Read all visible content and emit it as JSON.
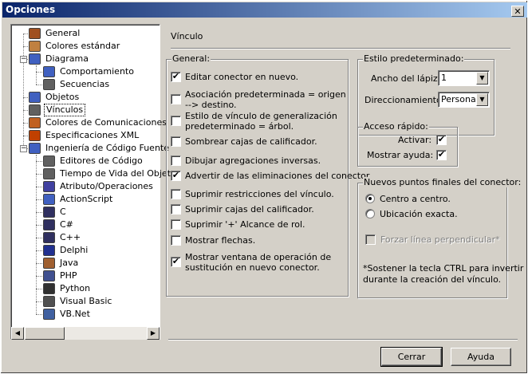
{
  "window": {
    "title": "Opciones",
    "close_glyph": "✕"
  },
  "tree": {
    "items": [
      {
        "label": "General",
        "icon": "general-icon",
        "color": "#a05020"
      },
      {
        "label": "Colores estándar",
        "icon": "colors-icon",
        "color": "#c08040"
      },
      {
        "label": "Diagrama",
        "icon": "diagram-icon",
        "color": "#4060c0"
      },
      {
        "label": "Comportamiento",
        "icon": "behavior-icon",
        "color": "#4060c0"
      },
      {
        "label": "Secuencias",
        "icon": "sequence-icon",
        "color": "#606060"
      },
      {
        "label": "Objetos",
        "icon": "objects-icon",
        "color": "#4060c0"
      },
      {
        "label": "Vínculos",
        "icon": "links-icon",
        "color": "#606060"
      },
      {
        "label": "Colores de Comunicaciones",
        "icon": "comm-colors-icon",
        "color": "#c06020"
      },
      {
        "label": "Especificaciones XML",
        "icon": "xml-icon",
        "color": "#c04000"
      },
      {
        "label": "Ingeniería de Código Fuente",
        "icon": "source-engineering-icon",
        "color": "#4060c0"
      },
      {
        "label": "Editores de Código",
        "icon": "code-editor-icon",
        "color": "#606060"
      },
      {
        "label": "Tiempo de Vida del Objeto",
        "icon": "object-lifetime-icon",
        "color": "#606060"
      },
      {
        "label": "Atributo/Operaciones",
        "icon": "attribute-icon",
        "color": "#4040a0"
      },
      {
        "label": "ActionScript",
        "icon": "actionscript-icon",
        "color": "#4060c0"
      },
      {
        "label": "C",
        "icon": "c-icon",
        "color": "#303060"
      },
      {
        "label": "C#",
        "icon": "csharp-icon",
        "color": "#303060"
      },
      {
        "label": "C++",
        "icon": "cpp-icon",
        "color": "#303060"
      },
      {
        "label": "Delphi",
        "icon": "delphi-icon",
        "color": "#203090"
      },
      {
        "label": "Java",
        "icon": "java-icon",
        "color": "#a06030"
      },
      {
        "label": "PHP",
        "icon": "php-icon",
        "color": "#405090"
      },
      {
        "label": "Python",
        "icon": "python-icon",
        "color": "#303030"
      },
      {
        "label": "Visual Basic",
        "icon": "visual-basic-icon",
        "color": "#505050"
      },
      {
        "label": "VB.Net",
        "icon": "vbnet-icon",
        "color": "#4060a0"
      }
    ],
    "selected_index": 6,
    "expanded_glyph": "−",
    "scroll_left_glyph": "◀",
    "scroll_right_glyph": "▶"
  },
  "panel": {
    "title": "Vínculo",
    "general": {
      "label": "General:",
      "options": [
        {
          "label": "Editar conector en nuevo.",
          "checked": true
        },
        {
          "label": "Asociación predeterminada = origen",
          "label2": "--> destino.",
          "checked": false
        },
        {
          "label": "Estilo de vínculo de generalización",
          "label2": "predeterminado  = árbol.",
          "checked": false
        },
        {
          "label": "Sombrear cajas de calificador.",
          "checked": false
        },
        {
          "label": "Dibujar agregaciones inversas.",
          "checked": false
        },
        {
          "label": "Advertir de las eliminaciones del conector.",
          "checked": true
        },
        {
          "label": "Suprimir restricciones del vínculo.",
          "checked": false
        },
        {
          "label": "Suprimir cajas del calificador.",
          "checked": false
        },
        {
          "label": "Suprimir '+' Alcance de rol.",
          "checked": false
        },
        {
          "label": "Mostrar flechas.",
          "checked": false
        },
        {
          "label": "Mostrar ventana de operación de",
          "label2": "sustitución en nuevo conector.",
          "checked": true
        }
      ]
    },
    "default_style": {
      "label": "Estilo predeterminado:",
      "pen_width_label": "Ancho del lápiz:",
      "pen_width_value": "1",
      "routing_label": "Direccionamiento:",
      "routing_value": "Personali",
      "dropdown_glyph": "▼"
    },
    "quick_access": {
      "label": "Acceso rápido:",
      "activate_label": "Activar:",
      "activate_checked": true,
      "show_help_label": "Mostrar ayuda:",
      "show_help_checked": true
    },
    "new_endpoints": {
      "label": "Nuevos puntos finales del conector:",
      "center_label": "Centro a centro.",
      "center_selected": true,
      "exact_label": "Ubicación exacta.",
      "exact_selected": false,
      "perpendicular_label": "Forzar línea perpendicular*",
      "perpendicular_checked": false,
      "note_line1": "*Sostener la tecla CTRL para invertir",
      "note_line2": "durante la creación del vínculo."
    }
  },
  "check_glyph": "✔",
  "buttons": {
    "close": "Cerrar",
    "help": "Ayuda"
  }
}
